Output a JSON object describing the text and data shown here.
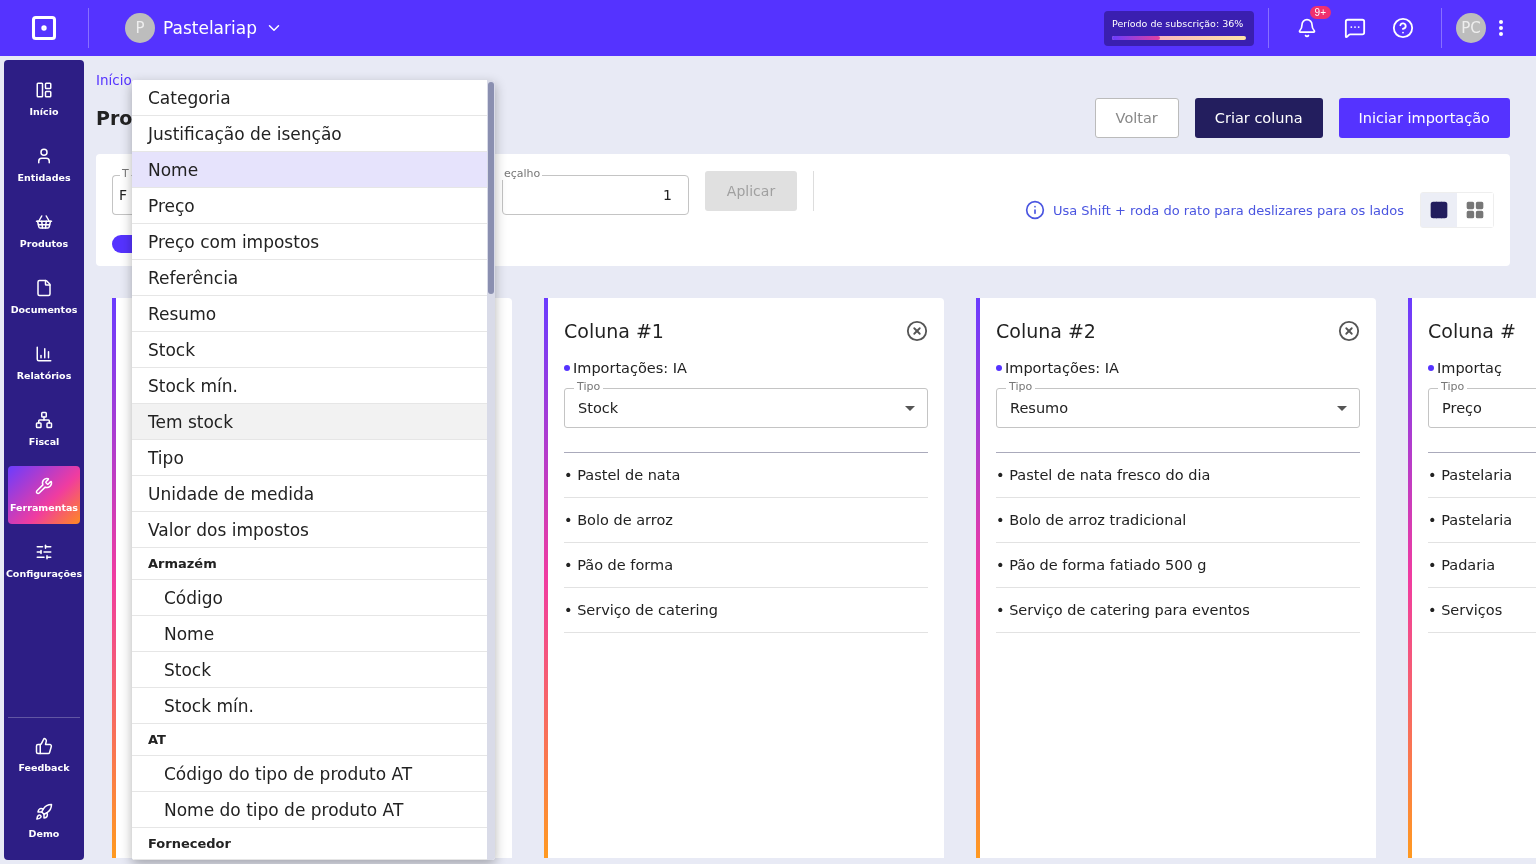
{
  "topbar": {
    "company": {
      "initial": "P",
      "name": "Pastelariap"
    },
    "subscription": {
      "label": "Período de subscrição: 36%",
      "level": 0.36
    },
    "notifications": {
      "badge": "9+"
    },
    "user": {
      "initials": "PC"
    }
  },
  "sidebar": {
    "items": [
      {
        "label": "Início",
        "selected": false
      },
      {
        "label": "Entidades",
        "selected": false
      },
      {
        "label": "Produtos",
        "selected": false
      },
      {
        "label": "Documentos",
        "selected": false
      },
      {
        "label": "Relatórios",
        "selected": false
      },
      {
        "label": "Fiscal",
        "selected": false
      },
      {
        "label": "Ferramentas",
        "selected": true
      },
      {
        "label": "Configurações",
        "selected": false
      }
    ],
    "bottom_items": [
      {
        "label": "Feedback",
        "selected": false
      },
      {
        "label": "Demo",
        "selected": false
      }
    ]
  },
  "breadcrumb": "Início",
  "title": "Pro",
  "actions": [
    {
      "label": "Voltar",
      "kind": "outline"
    },
    {
      "label": "Criar coluna",
      "kind": "dark"
    },
    {
      "label": "Iniciar importação",
      "kind": "primary"
    }
  ],
  "filter": {
    "left_field": {
      "label": "T",
      "value": "F"
    },
    "header_field": {
      "label": "eçalho",
      "value": "1"
    },
    "apply": {
      "label": "Aplicar",
      "disabled": true
    },
    "toggle": {
      "on": true
    },
    "hint": "Usa Shift + roda do rato para deslizares para os lados",
    "views": [
      {
        "selected": true
      },
      {
        "selected": false
      }
    ]
  },
  "columns": [
    {
      "kind": "covered"
    },
    {
      "kind": "full",
      "title": "Coluna #1",
      "source": "Importações: IA",
      "type_label": "Tipo",
      "type_value": "Stock",
      "items": [
        "• Pastel de nata",
        "• Bolo de arroz",
        "• Pão de forma",
        "• Serviço de catering"
      ]
    },
    {
      "kind": "full",
      "title": "Coluna #2",
      "source": "Importações: IA",
      "type_label": "Tipo",
      "type_value": "Resumo",
      "items": [
        "• Pastel de nata fresco do dia",
        "• Bolo de arroz tradicional",
        "• Pão de forma fatiado 500 g",
        "• Serviço de catering para eventos"
      ]
    },
    {
      "kind": "clipped",
      "title": "Coluna #",
      "source": "Importaç",
      "type_label": "Tipo",
      "type_value": "Preço",
      "items": [
        "• Pastelaria",
        "• Pastelaria",
        "• Padaria",
        "• Serviços"
      ]
    }
  ],
  "menu": {
    "items": [
      {
        "kind": "option",
        "label": "Categoria",
        "selected": false,
        "hovered": false
      },
      {
        "kind": "option",
        "label": "Justificação de isenção",
        "selected": false,
        "hovered": false
      },
      {
        "kind": "option",
        "label": "Nome",
        "selected": true,
        "hovered": false
      },
      {
        "kind": "option",
        "label": "Preço",
        "selected": false,
        "hovered": false
      },
      {
        "kind": "option",
        "label": "Preço com impostos",
        "selected": false,
        "hovered": false
      },
      {
        "kind": "option",
        "label": "Referência",
        "selected": false,
        "hovered": false
      },
      {
        "kind": "option",
        "label": "Resumo",
        "selected": false,
        "hovered": false
      },
      {
        "kind": "option",
        "label": "Stock",
        "selected": false,
        "hovered": false
      },
      {
        "kind": "option",
        "label": "Stock mín.",
        "selected": false,
        "hovered": false
      },
      {
        "kind": "option",
        "label": "Tem stock",
        "selected": false,
        "hovered": true
      },
      {
        "kind": "option",
        "label": "Tipo",
        "selected": false,
        "hovered": false
      },
      {
        "kind": "option",
        "label": "Unidade de medida",
        "selected": false,
        "hovered": false
      },
      {
        "kind": "option",
        "label": "Valor dos impostos",
        "selected": false,
        "hovered": false
      },
      {
        "kind": "group",
        "label": "Armazém"
      },
      {
        "kind": "suboption",
        "label": "Código",
        "selected": false,
        "hovered": false
      },
      {
        "kind": "suboption",
        "label": "Nome",
        "selected": false,
        "hovered": false
      },
      {
        "kind": "suboption",
        "label": "Stock",
        "selected": false,
        "hovered": false
      },
      {
        "kind": "suboption",
        "label": "Stock mín.",
        "selected": false,
        "hovered": false
      },
      {
        "kind": "group",
        "label": "AT"
      },
      {
        "kind": "suboption",
        "label": "Código do tipo de produto AT",
        "selected": false,
        "hovered": false
      },
      {
        "kind": "suboption",
        "label": "Nome do tipo de produto AT",
        "selected": false,
        "hovered": false
      },
      {
        "kind": "group",
        "label": "Fornecedor"
      }
    ]
  }
}
